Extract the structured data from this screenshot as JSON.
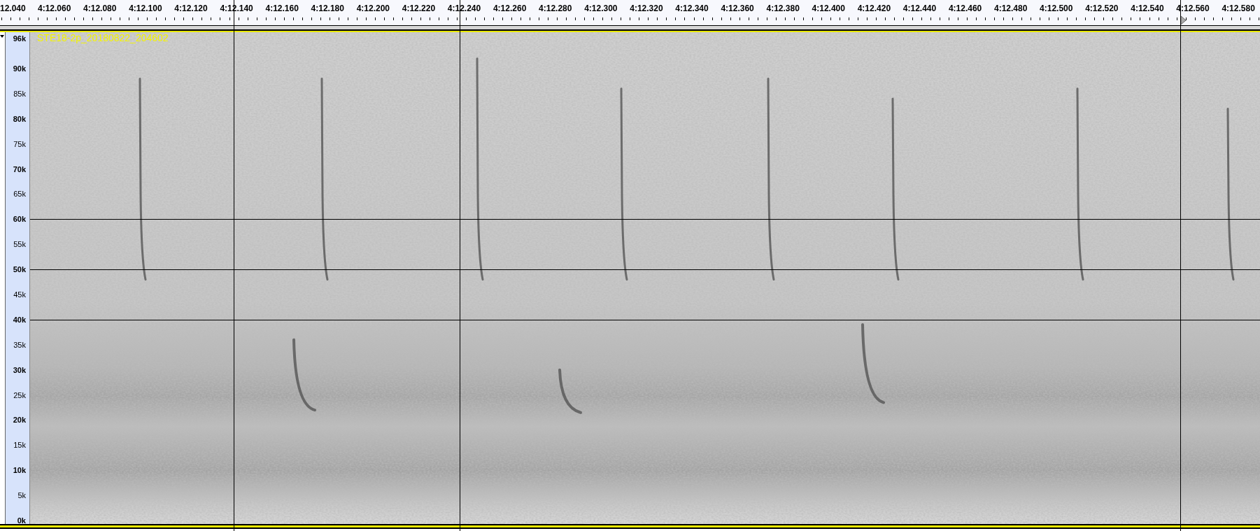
{
  "ruler": {
    "labels": [
      "12.040",
      "4:12.060",
      "4:12.080",
      "4:12.100",
      "4:12.120",
      "4:12.140",
      "4:12.160",
      "4:12.180",
      "4:12.200",
      "4:12.220",
      "4:12.240",
      "4:12.260",
      "4:12.280",
      "4:12.300",
      "4:12.320",
      "4:12.340",
      "4:12.360",
      "4:12.380",
      "4:12.400",
      "4:12.420",
      "4:12.440",
      "4:12.460",
      "4:12.480",
      "4:12.500",
      "4:12.520",
      "4:12.540",
      "4:12.560",
      "4:12.580"
    ]
  },
  "track": {
    "title": "STE18-2p_20180822_204602",
    "y_axis": [
      {
        "label": "96k",
        "major": true
      },
      {
        "label": "90k",
        "major": true
      },
      {
        "label": "85k",
        "major": false
      },
      {
        "label": "80k",
        "major": true
      },
      {
        "label": "75k",
        "major": false
      },
      {
        "label": "70k",
        "major": true
      },
      {
        "label": "65k",
        "major": false
      },
      {
        "label": "60k",
        "major": true
      },
      {
        "label": "55k",
        "major": false
      },
      {
        "label": "50k",
        "major": true
      },
      {
        "label": "45k",
        "major": false
      },
      {
        "label": "40k",
        "major": true
      },
      {
        "label": "35k",
        "major": false
      },
      {
        "label": "30k",
        "major": true
      },
      {
        "label": "25k",
        "major": false
      },
      {
        "label": "20k",
        "major": true
      },
      {
        "label": "15k",
        "major": false
      },
      {
        "label": "10k",
        "major": true
      },
      {
        "label": "5k",
        "major": false
      },
      {
        "label": "0k",
        "major": true
      }
    ]
  }
}
